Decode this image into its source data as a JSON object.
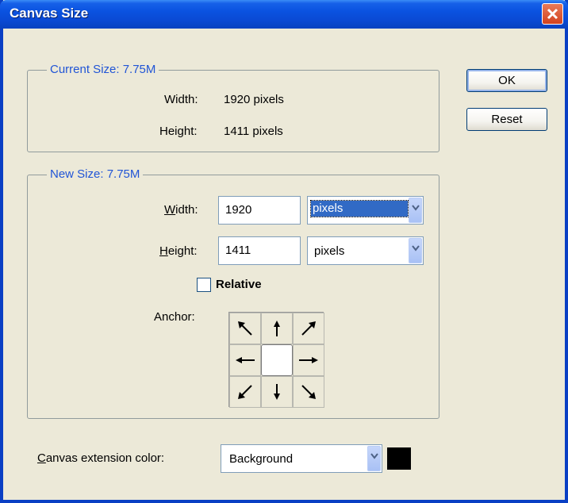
{
  "window": {
    "title": "Canvas Size"
  },
  "current_size": {
    "legend": "Current Size: 7.75M",
    "width_label": "Width:",
    "width_value": "1920 pixels",
    "height_label": "Height:",
    "height_value": "1411 pixels"
  },
  "new_size": {
    "legend": "New Size: 7.75M",
    "width_label_u": "W",
    "width_label_rest": "idth:",
    "width_value": "1920",
    "width_unit": "pixels",
    "height_label_u": "H",
    "height_label_rest": "eight:",
    "height_value": "1411",
    "height_unit": "pixels",
    "relative_label": "Relative",
    "relative_checked": false,
    "anchor_label": "Anchor:"
  },
  "buttons": {
    "ok": "OK",
    "reset": "Reset"
  },
  "extension": {
    "label_u": "C",
    "label_rest": "anvas extension color:",
    "value": "Background",
    "swatch_color": "#000000"
  },
  "colors": {
    "accent": "#2155d6",
    "titlebar": "#0a52e0",
    "selection": "#316ac5"
  }
}
